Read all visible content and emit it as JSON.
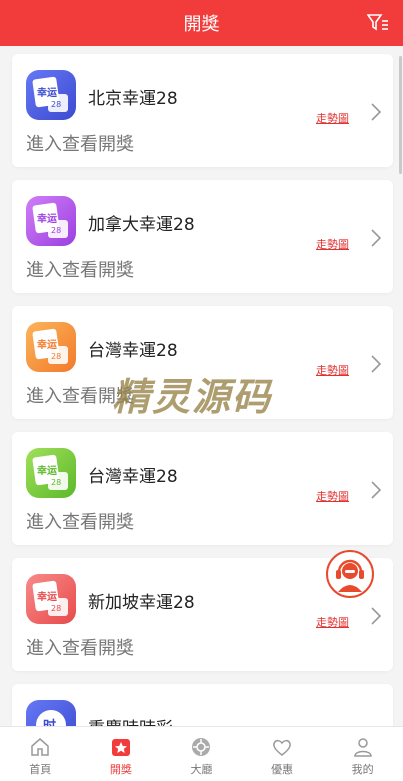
{
  "header": {
    "title": "開獎"
  },
  "lotteries": [
    {
      "name": "北京幸運28",
      "subtitle": "進入查看開獎",
      "trend": "走勢圖",
      "logo_text": "幸运",
      "logo_num": "28",
      "color1": "#5a6cf0",
      "color2": "#3c4ad0"
    },
    {
      "name": "加拿大幸運28",
      "subtitle": "進入查看開獎",
      "trend": "走勢圖",
      "logo_text": "幸运",
      "logo_num": "28",
      "color1": "#c46af2",
      "color2": "#9b3fe0"
    },
    {
      "name": "台灣幸運28",
      "subtitle": "進入查看開獎",
      "trend": "走勢圖",
      "logo_text": "幸运",
      "logo_num": "28",
      "color1": "#f9a64a",
      "color2": "#f27a2a"
    },
    {
      "name": "台灣幸運28",
      "subtitle": "進入查看開獎",
      "trend": "走勢圖",
      "logo_text": "幸运",
      "logo_num": "28",
      "color1": "#8fd64a",
      "color2": "#5cb82a"
    },
    {
      "name": "新加坡幸運28",
      "subtitle": "進入查看開獎",
      "trend": "走勢圖",
      "logo_text": "幸运",
      "logo_num": "28",
      "color1": "#f57a7a",
      "color2": "#e84a4a"
    },
    {
      "name": "重慶時時彩",
      "subtitle": "",
      "trend": "",
      "logo_text": "时",
      "logo_num": "",
      "color1": "#5a6cf0",
      "color2": "#3c4ad0"
    }
  ],
  "watermark": "精灵源码",
  "tabs": [
    {
      "label": "首頁",
      "icon": "home-icon"
    },
    {
      "label": "開獎",
      "icon": "star-icon",
      "active": true
    },
    {
      "label": "大廳",
      "icon": "hall-icon"
    },
    {
      "label": "優惠",
      "icon": "heart-icon"
    },
    {
      "label": "我的",
      "icon": "user-icon"
    }
  ],
  "colors": {
    "brand": "#f23c3c",
    "link": "#e23030"
  }
}
